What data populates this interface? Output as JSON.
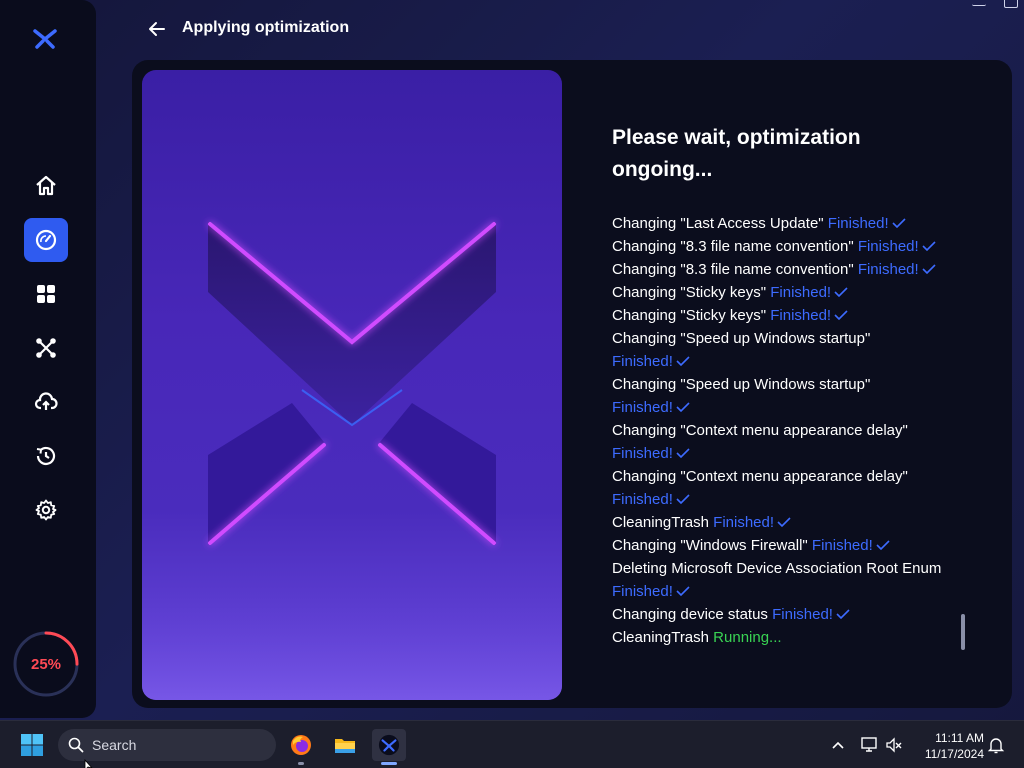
{
  "app": {
    "progress_percent": 25,
    "progress_label": "25%",
    "accent_color": "#2f5bf0",
    "progress_color": "#ff4a55"
  },
  "sidebar": {
    "logo": "x-logo-icon",
    "items": [
      {
        "name": "home",
        "icon": "home-icon",
        "active": false
      },
      {
        "name": "optimize",
        "icon": "speedometer-icon",
        "active": true
      },
      {
        "name": "apps",
        "icon": "grid-icon",
        "active": false
      },
      {
        "name": "network",
        "icon": "network-icon",
        "active": false
      },
      {
        "name": "cloud",
        "icon": "cloud-upload-icon",
        "active": false
      },
      {
        "name": "restore",
        "icon": "history-icon",
        "active": false
      },
      {
        "name": "settings",
        "icon": "gear-icon",
        "active": false
      }
    ]
  },
  "header": {
    "title": "Applying optimization"
  },
  "main": {
    "status_title": "Please wait, optimization ongoing...",
    "log": [
      {
        "text": "Changing \"Last Access Update\"",
        "status": "Finished!",
        "state": "finished",
        "wrap": false
      },
      {
        "text": "Changing \"8.3 file name convention\"",
        "status": "Finished!",
        "state": "finished",
        "wrap": false
      },
      {
        "text": "Changing \"8.3 file name convention\"",
        "status": "Finished!",
        "state": "finished",
        "wrap": false
      },
      {
        "text": "Changing \"Sticky keys\"",
        "status": "Finished!",
        "state": "finished",
        "wrap": false
      },
      {
        "text": "Changing \"Sticky keys\"",
        "status": "Finished!",
        "state": "finished",
        "wrap": false
      },
      {
        "text": "Changing \"Speed up Windows startup\"",
        "status": "Finished!",
        "state": "finished",
        "wrap": true
      },
      {
        "text": "Changing \"Speed up Windows startup\"",
        "status": "Finished!",
        "state": "finished",
        "wrap": true
      },
      {
        "text": "Changing \"Context menu appearance delay\"",
        "status": "Finished!",
        "state": "finished",
        "wrap": true
      },
      {
        "text": "Changing \"Context menu appearance delay\"",
        "status": "Finished!",
        "state": "finished",
        "wrap": true
      },
      {
        "text": "CleaningTrash",
        "status": "Finished!",
        "state": "finished",
        "wrap": false
      },
      {
        "text": "Changing \"Windows Firewall\"",
        "status": "Finished!",
        "state": "finished",
        "wrap": false
      },
      {
        "text": "Deleting Microsoft Device Association Root Enum",
        "status": "Finished!",
        "state": "finished",
        "wrap": true
      },
      {
        "text": "Changing device status",
        "status": "Finished!",
        "state": "finished",
        "wrap": false
      },
      {
        "text": "CleaningTrash",
        "status": "Running...",
        "state": "running",
        "wrap": false
      }
    ],
    "finished_color": "#3d6bff",
    "running_color": "#39d353"
  },
  "taskbar": {
    "search_placeholder": "Search",
    "time": "11:11 AM",
    "date": "11/17/2024",
    "apps": [
      "windows-start-icon",
      "firefox-icon",
      "file-explorer-icon",
      "x-app-icon"
    ],
    "tray": [
      "chevron-up-icon",
      "network-icon",
      "volume-muted-icon",
      "bell-icon"
    ]
  }
}
